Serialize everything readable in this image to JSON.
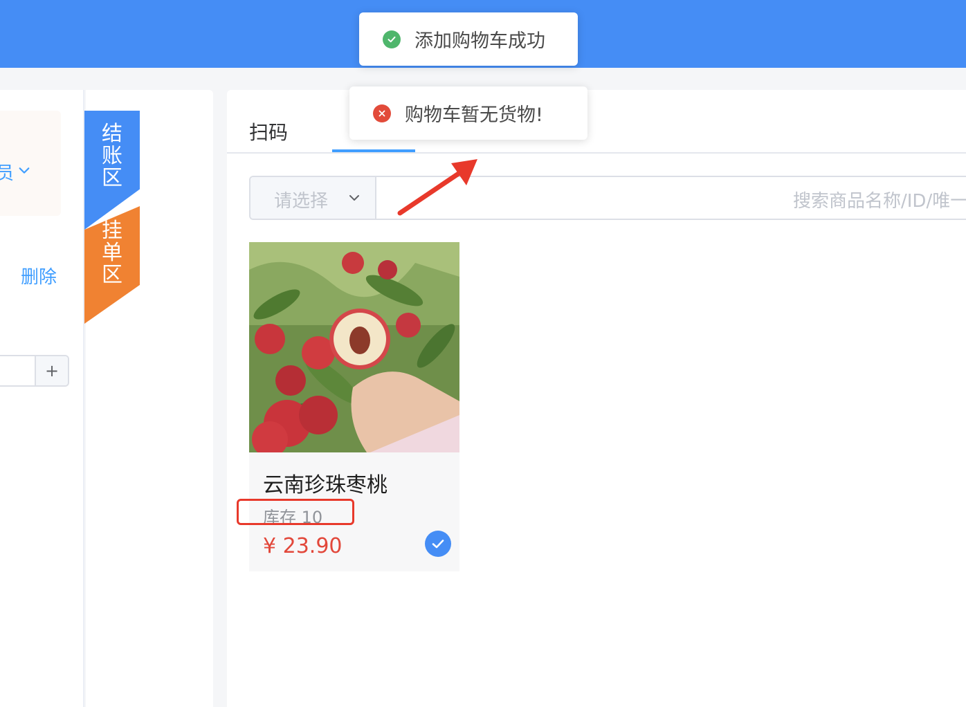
{
  "colors": {
    "header": "#458df5",
    "accent": "#409eff",
    "checkout_ribbon": "#458df5",
    "hold_ribbon": "#f08232",
    "price": "#e2473a",
    "highlight": "#e8392b",
    "toast_success": "#4fb66c",
    "toast_error": "#e24b3a"
  },
  "left_panel": {
    "member_label": "员",
    "member_icon": "chevron-down-icon",
    "delete_label": "删除",
    "stepper_plus": "+"
  },
  "ribbons": {
    "checkout": [
      "结",
      "账",
      "区"
    ],
    "hold": [
      "挂",
      "单",
      "区"
    ]
  },
  "main": {
    "tab_scan": "扫码",
    "select_placeholder": "请选择",
    "select_icon": "chevron-down-icon",
    "search_placeholder": "搜索商品名称/ID/唯一码"
  },
  "product": {
    "name": "云南珍珠枣桃",
    "stock": "库存 10",
    "price": "¥ 23.90",
    "selected_icon": "check-icon"
  },
  "toasts": {
    "success": {
      "text": "添加购物车成功",
      "icon": "check-circle-icon"
    },
    "error": {
      "text": "购物车暂无货物!",
      "icon": "close-circle-icon"
    }
  }
}
